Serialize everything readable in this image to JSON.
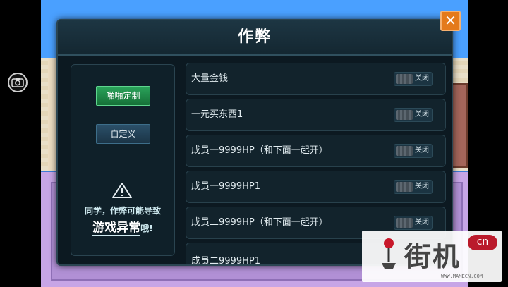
{
  "dialog": {
    "title": "作弊",
    "close_glyph": "✕",
    "colors": {
      "accent_green": "#1f8a4a",
      "close_orange": "#e47a1b",
      "panel_bg": "#0c1921"
    }
  },
  "left_panel": {
    "preset_button": "啪啪定制",
    "custom_button": "自定义",
    "warning_icon": "warning-triangle-icon",
    "warning_line1": "同学，作弊可能导致",
    "warning_strong": "游戏异常",
    "warning_suffix": "哦!"
  },
  "options": [
    {
      "label": "大量金钱",
      "state": "关闭"
    },
    {
      "label": "一元买东西1",
      "state": "关闭"
    },
    {
      "label": "成员一9999HP（和下面一起开）",
      "state": "关闭"
    },
    {
      "label": "成员一9999HP1",
      "state": "关闭"
    },
    {
      "label": "成员二9999HP（和下面一起开）",
      "state": "关闭"
    },
    {
      "label": "成员二9999HP1",
      "state": ""
    }
  ],
  "sidebar": {
    "camera_icon": "camera-icon"
  },
  "watermark": {
    "logo_text": "街机",
    "badge": "cn",
    "url": "WWW.MAMECN.COM"
  }
}
